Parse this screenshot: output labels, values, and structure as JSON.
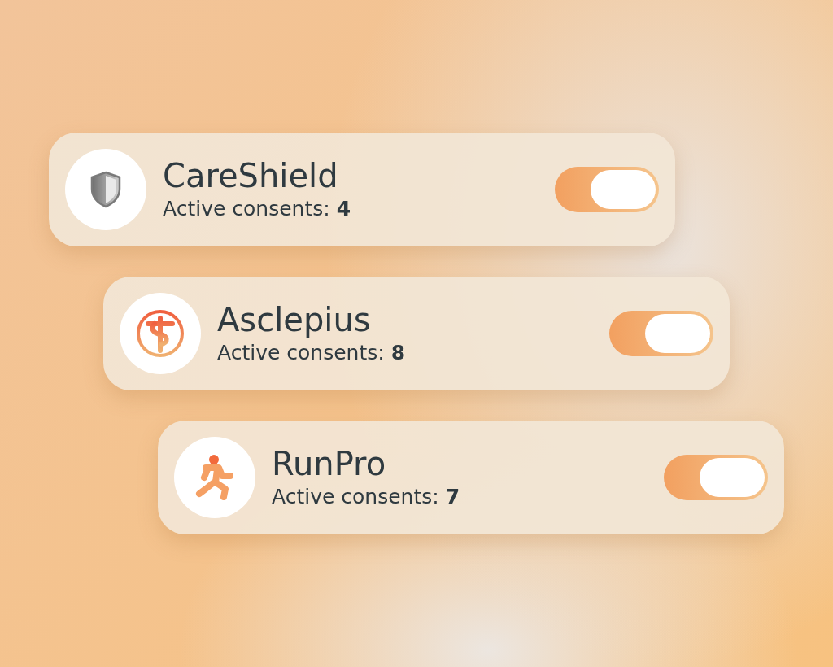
{
  "apps": [
    {
      "kind": "shield",
      "name": "CareShield",
      "label": "Active consents:",
      "count": "4",
      "on": true
    },
    {
      "kind": "medical",
      "name": "Asclepius",
      "label": "Active consents:",
      "count": "8",
      "on": true
    },
    {
      "kind": "runner",
      "name": "RunPro",
      "label": "Active consents:",
      "count": "7",
      "on": true
    }
  ]
}
